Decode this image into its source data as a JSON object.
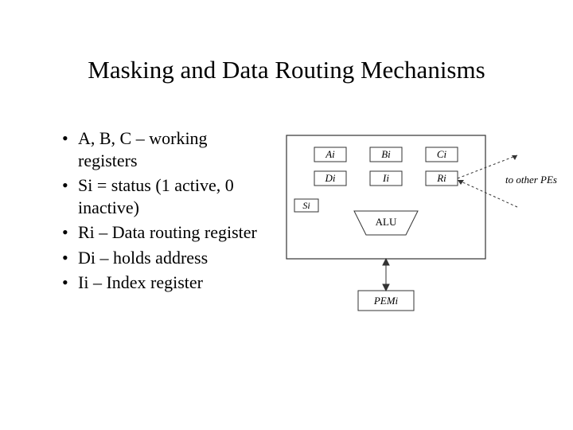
{
  "title": "Masking and Data Routing Mechanisms",
  "bullets": [
    "A, B, C – working registers",
    "Si = status (1 active, 0 inactive)",
    "Ri – Data routing register",
    "Di – holds address",
    "Ii – Index register"
  ],
  "diagram": {
    "regs_row1": [
      "Ai",
      "Bi",
      "Ci"
    ],
    "regs_row2": [
      "Di",
      "Ii",
      "Ri"
    ],
    "status": "Si",
    "alu": "ALU",
    "mem": "PEMi",
    "side_label": "to other PEs"
  }
}
